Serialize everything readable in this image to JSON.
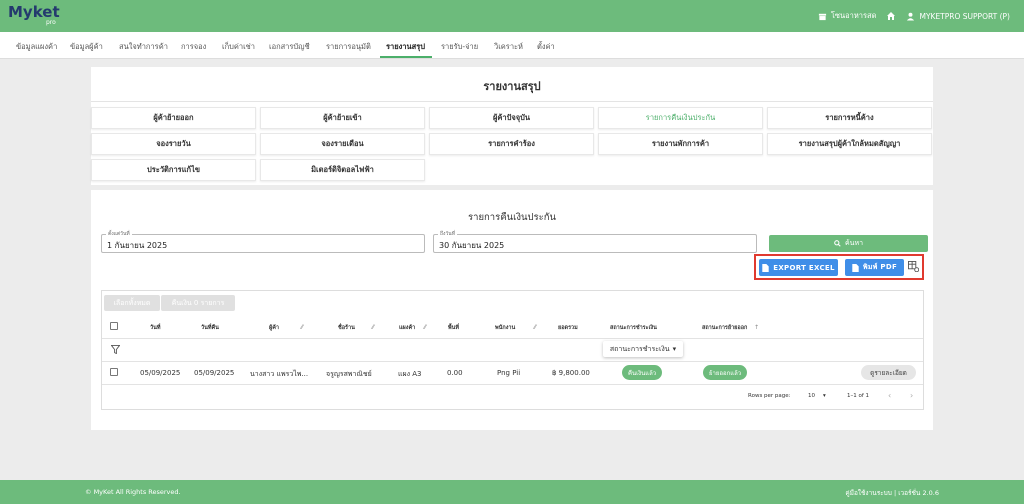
{
  "app": {
    "logo_main": "Myket",
    "logo_sub": "pro"
  },
  "header": {
    "shop_label": "โซนอาหารสด",
    "user_label": "MYKETPRO SUPPORT (P)"
  },
  "nav": {
    "items": [
      {
        "label": "ข้อมูลแผงค้า"
      },
      {
        "label": "ข้อมูลผู้ค้า"
      },
      {
        "label": "สนใจทำการค้า"
      },
      {
        "label": "การจอง"
      },
      {
        "label": "เก็บค่าเช่า"
      },
      {
        "label": "เอกสารบัญชี"
      },
      {
        "label": "รายการอนุมัติ"
      },
      {
        "label": "รายงานสรุป"
      },
      {
        "label": "รายรับ-จ่าย"
      },
      {
        "label": "วิเคราะห์"
      },
      {
        "label": "ตั้งค่า"
      }
    ],
    "active_index": 7
  },
  "report": {
    "title": "รายงานสรุป",
    "buttons": [
      {
        "label": "ผู้ค้าย้ายออก"
      },
      {
        "label": "ผู้ค้าย้ายเข้า"
      },
      {
        "label": "ผู้ค้าปัจจุบัน"
      },
      {
        "label": "รายการคืนเงินประกัน"
      },
      {
        "label": "รายการหนี้ค้าง"
      },
      {
        "label": "จองรายวัน"
      },
      {
        "label": "จองรายเดือน"
      },
      {
        "label": "รายการคำร้อง"
      },
      {
        "label": "รายงานพักการค้า"
      },
      {
        "label": "รายงานสรุปผู้ค้าใกล้หมดสัญญา"
      },
      {
        "label": "ประวัติการแก้ไข"
      },
      {
        "label": "มิเตอร์ดิจิตอลไฟฟ้า"
      }
    ],
    "active_button": "รายการคืนเงินประกัน"
  },
  "refund": {
    "title": "รายการคืนเงินประกัน",
    "from_label": "ตั้งแต่วันที่",
    "from_value": "1 กันยายน 2025",
    "to_label": "ถึงวันที่",
    "to_value": "30 กันยายน 2025",
    "search_label": "ค้นหา",
    "export_excel_label": "EXPORT EXCEL",
    "print_pdf_label": "พิมพ์ PDF",
    "select_all_label": "เลือกทั้งหมด",
    "refund_count_label": "คืนเงิน 0 รายการ",
    "columns": [
      "วันที่",
      "วันที่คืน",
      "ผู้ค้า",
      "ชื่อร้าน",
      "แผงค้า",
      "พื้นที่",
      "พนักงาน",
      "ยอดรวม",
      "สถานะการชำระเงิน",
      "สถานะการย้ายออก"
    ],
    "status_filter_label": "สถานะการชำระเงิน",
    "rows": [
      {
        "date": "05/09/2025",
        "return_date": "05/09/2025",
        "vendor": "นางสาว แพรวไพ...",
        "shop": "จรูญรสพาณิชย์",
        "stall": "แผง A3",
        "area": "0.00",
        "staff": "Png Pii",
        "total": "฿ 9,800.00",
        "payment_status": "คืนเงินแล้ว",
        "moveout_status": "ย้ายออกแล้ว",
        "detail_label": "ดูรายละเอียด"
      }
    ],
    "rows_per_page_label": "Rows per page:",
    "rows_per_page_value": "10",
    "page_range": "1–1 of 1"
  },
  "footer": {
    "copyright": "© MyKet All Rights Reserved.",
    "version": "คู่มือใช้งานระบบ | เวอร์ชั่น 2.0.6"
  },
  "colors": {
    "primary_green": "#6dbb7c",
    "button_blue": "#3f8ee8",
    "highlight_red": "#e03a2f"
  }
}
